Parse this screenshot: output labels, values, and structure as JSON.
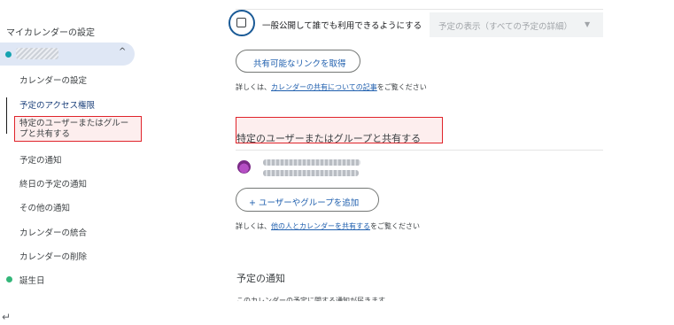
{
  "sidebar": {
    "heading": "マイカレンダーの設定",
    "calendar_chevron": "^",
    "items": [
      {
        "label": "カレンダーの設定"
      },
      {
        "label": "予定のアクセス権限"
      },
      {
        "label_line1": "特定のユーザーまたはグルー",
        "label_line2": "プと共有する"
      },
      {
        "label": "予定の通知"
      },
      {
        "label": "終日の予定の通知"
      },
      {
        "label": "その他の通知"
      },
      {
        "label": "カレンダーの統合"
      },
      {
        "label": "カレンダーの削除"
      }
    ],
    "birthday_label": "誕生日",
    "return_glyph": "↵",
    "colors": {
      "calendar_dot": "#16a3b0",
      "birthday_dot": "#33b679",
      "selected_bg": "#dfe7f5"
    }
  },
  "main": {
    "public_checkbox_label": "一般公開して誰でも利用できるようにする",
    "visibility_select": "予定の表示（すべての予定の詳細）",
    "get_link_button": "共有可能なリンクを取得",
    "help1_prefix": "詳しくは、",
    "help1_link": "カレンダーの共有についての記事",
    "help1_suffix": "をご覧ください",
    "share_section_title": "特定のユーザーまたはグループと共有する",
    "add_button": "+ ユーザーやグループを追加",
    "help2_prefix": "詳しくは、",
    "help2_link": "他の人とカレンダーを共有する",
    "help2_suffix": "をご覧ください",
    "notification_title": "予定の通知",
    "notification_desc": "このカレンダーの予定に関する通知が届きます"
  },
  "colors": {
    "highlight": "#e0242b",
    "link": "#1f5fae",
    "focus_ring": "#1a5a96"
  }
}
